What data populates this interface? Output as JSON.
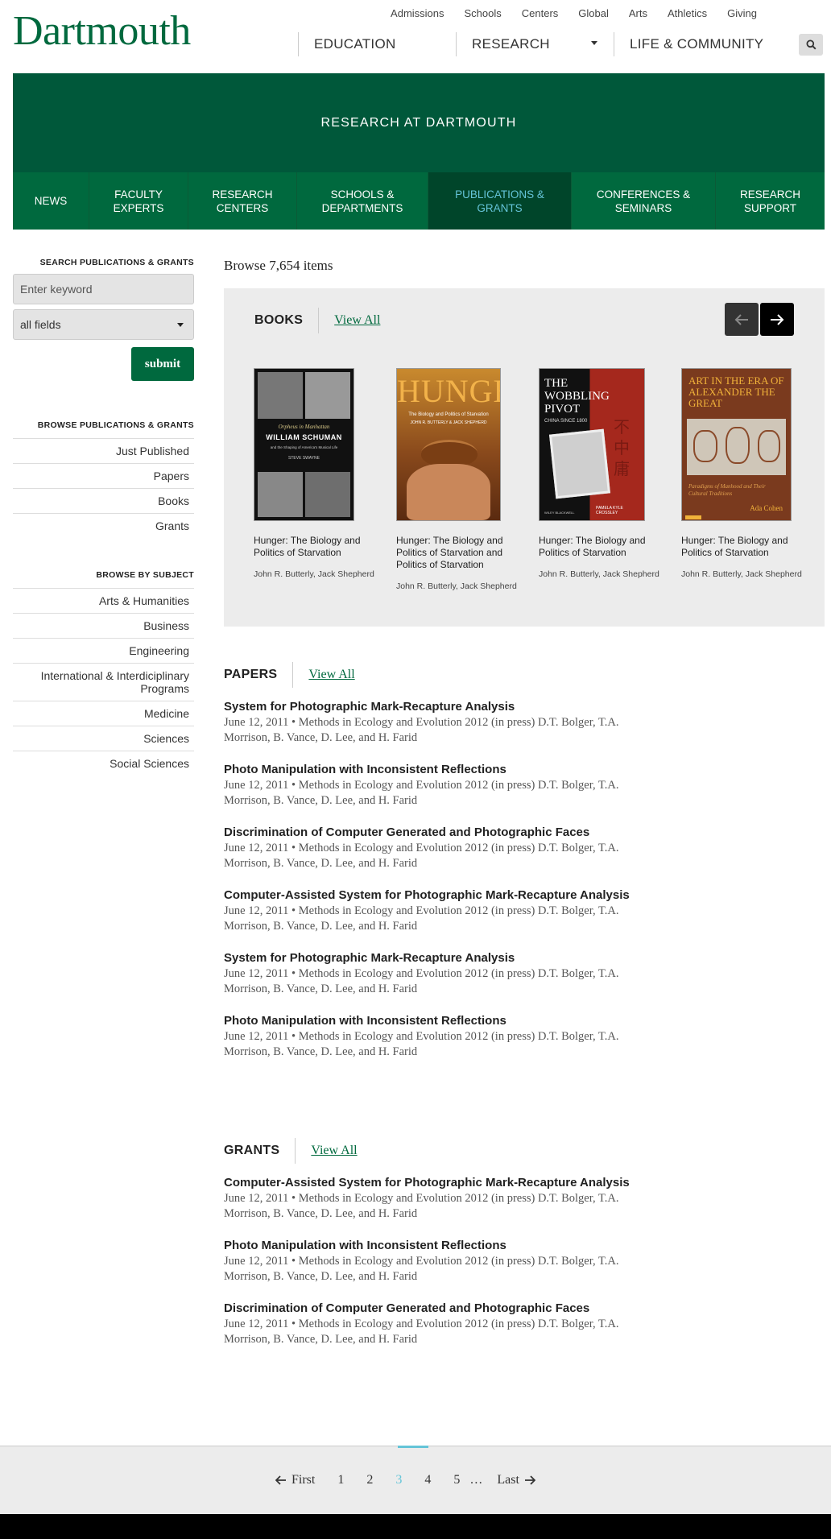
{
  "header": {
    "logo": "Dartmouth",
    "utility_nav": [
      "Admissions",
      "Schools",
      "Centers",
      "Global",
      "Arts",
      "Athletics",
      "Giving"
    ],
    "main_nav": [
      "EDUCATION",
      "RESEARCH",
      "LIFE & COMMUNITY"
    ]
  },
  "banner": {
    "title": "RESEARCH AT DARTMOUTH"
  },
  "section_nav": [
    {
      "label": "NEWS",
      "active": false
    },
    {
      "label": "FACULTY EXPERTS",
      "active": false
    },
    {
      "label": "RESEARCH CENTERS",
      "active": false
    },
    {
      "label": "SCHOOLS & DEPARTMENTS",
      "active": false
    },
    {
      "label": "PUBLICATIONS & GRANTS",
      "active": true
    },
    {
      "label": "CONFERENCES & SEMINARS",
      "active": false
    },
    {
      "label": "RESEARCH SUPPORT",
      "active": false
    }
  ],
  "sidebar": {
    "search_heading": "SEARCH PUBLICATIONS & GRANTS",
    "keyword_placeholder": "Enter keyword",
    "field_select_value": "all fields",
    "submit_label": "submit",
    "browse_heading": "BROWSE PUBLICATIONS & GRANTS",
    "browse_items": [
      "Just Published",
      "Papers",
      "Books",
      "Grants"
    ],
    "subject_heading": "BROWSE BY SUBJECT",
    "subject_items": [
      "Arts & Humanities",
      "Business",
      "Engineering",
      "International & Interdiciplinary Programs",
      "Medicine",
      "Sciences",
      "Social Sciences"
    ]
  },
  "main": {
    "browse_count": "Browse 7,654 items",
    "books": {
      "heading": "BOOKS",
      "view_all": "View All",
      "items": [
        {
          "title": "Hunger: The Biology and Politics of Starvation",
          "authors": "John R. Butterly, Jack Shepherd",
          "cover_lines": [
            "Orpheus in Manhattan",
            "WILLIAM SCHUMAN",
            "and the Shaping of America's Musical Life",
            "STEVE SWAYNE"
          ]
        },
        {
          "title": "Hunger: The Biology and Politics of Starvation and Politics of Starvation",
          "authors": "John R. Butterly, Jack Shepherd",
          "cover_lines": [
            "HUNGER",
            "The Biology and Politics of Starvation",
            "JOHN R. BUTTERLY & JACK SHEPHERD"
          ]
        },
        {
          "title": "Hunger: The Biology and Politics of Starvation",
          "authors": "John R. Butterly, Jack Shepherd",
          "cover_lines": [
            "THE WOBBLING PIVOT",
            "CHINA SINCE 1800",
            "PAMELA KYLE CROSSLEY",
            "WILEY BLACKWELL"
          ]
        },
        {
          "title": "Hunger: The Biology and Politics of Starvation",
          "authors": "John R. Butterly, Jack Shepherd",
          "cover_lines": [
            "ART IN THE ERA OF ALEXANDER THE GREAT",
            "Paradigms of Manhood and Their Cultural Traditions",
            "Ada Cohen"
          ]
        }
      ]
    },
    "papers": {
      "heading": "PAPERS",
      "view_all": "View All",
      "items": [
        {
          "title": "System for Photographic Mark-Recapture Analysis",
          "meta": "June 12, 2011 • Methods in Ecology and Evolution 2012 (in press) D.T. Bolger, T.A. Morrison, B. Vance, D. Lee, and H. Farid"
        },
        {
          "title": "Photo Manipulation with Inconsistent Reflections",
          "meta": "June 12, 2011 • Methods in Ecology and Evolution 2012 (in press) D.T. Bolger, T.A. Morrison, B. Vance, D. Lee, and H. Farid"
        },
        {
          "title": "Discrimination of Computer Generated and Photographic Faces",
          "meta": "June 12, 2011 • Methods in Ecology and Evolution 2012 (in press) D.T. Bolger, T.A. Morrison, B. Vance, D. Lee, and H. Farid"
        },
        {
          "title": "Computer-Assisted System for Photographic Mark-Recapture Analysis",
          "meta": "June 12, 2011 • Methods in Ecology and Evolution 2012 (in press) D.T. Bolger, T.A. Morrison, B. Vance, D. Lee, and H. Farid"
        },
        {
          "title": "System for Photographic Mark-Recapture Analysis",
          "meta": "June 12, 2011 • Methods in Ecology and Evolution 2012 (in press) D.T. Bolger, T.A. Morrison, B. Vance, D. Lee, and H. Farid"
        },
        {
          "title": "Photo Manipulation with Inconsistent Reflections",
          "meta": "June 12, 2011 • Methods in Ecology and Evolution 2012 (in press) D.T. Bolger, T.A. Morrison, B. Vance, D. Lee, and H. Farid"
        }
      ]
    },
    "grants": {
      "heading": "GRANTS",
      "view_all": "View All",
      "items": [
        {
          "title": "Computer-Assisted System for Photographic Mark-Recapture Analysis",
          "meta": "June 12, 2011 • Methods in Ecology and Evolution 2012 (in press) D.T. Bolger, T.A. Morrison, B. Vance, D. Lee, and H. Farid"
        },
        {
          "title": "Photo Manipulation with Inconsistent Reflections",
          "meta": "June 12, 2011 • Methods in Ecology and Evolution 2012 (in press) D.T. Bolger, T.A. Morrison, B. Vance, D. Lee, and H. Farid"
        },
        {
          "title": "Discrimination of Computer Generated and Photographic Faces",
          "meta": "June 12, 2011 • Methods in Ecology and Evolution 2012 (in press) D.T. Bolger, T.A. Morrison, B. Vance, D. Lee, and H. Farid"
        }
      ]
    }
  },
  "pagination": {
    "first": "First",
    "pages": [
      "1",
      "2",
      "3",
      "4",
      "5"
    ],
    "current_page": "3",
    "ellipsis": "…",
    "last": "Last"
  },
  "colors": {
    "brand_green": "#00693e",
    "banner_green": "#00583a",
    "active_nav_bg": "#00452a",
    "accent_blue": "#64c4d8"
  },
  "icons": {
    "search": "search-icon",
    "prev_arrow": "arrow-left-icon",
    "next_arrow": "arrow-right-icon",
    "dropdown": "chevron-down-icon"
  }
}
